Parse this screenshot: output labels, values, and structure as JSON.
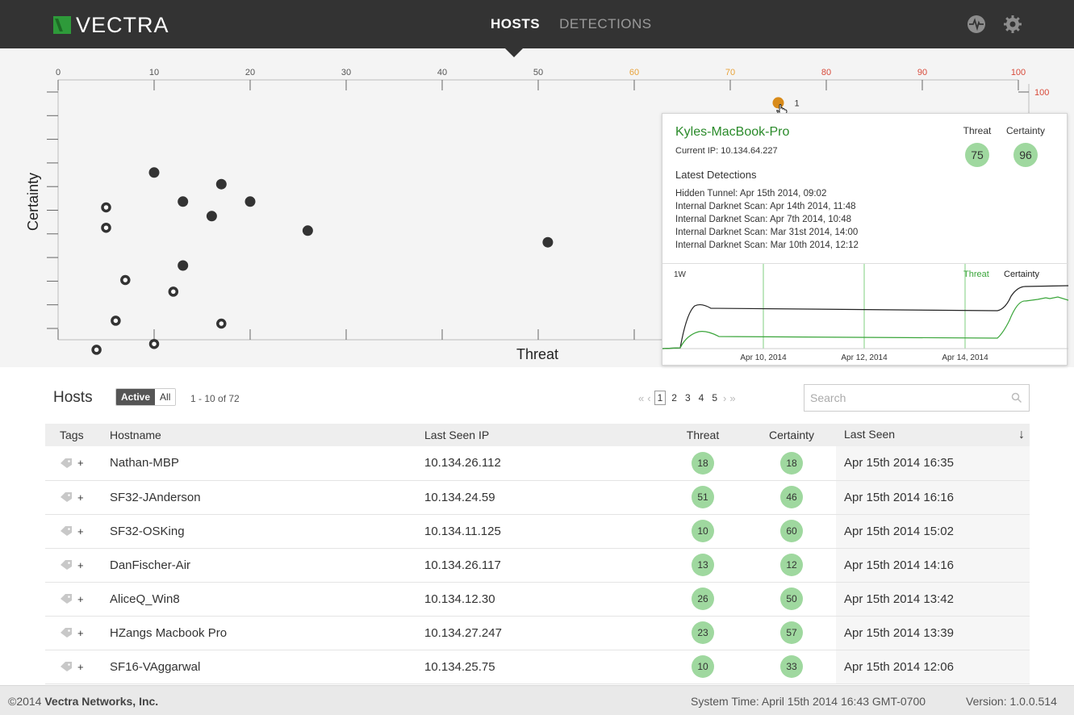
{
  "header": {
    "brand": "VECTRA",
    "tabs": [
      {
        "label": "HOSTS",
        "active": true
      },
      {
        "label": "DETECTIONS",
        "active": false
      }
    ],
    "icons": [
      "heartbeat-icon",
      "gear-icon"
    ]
  },
  "chart_data": {
    "type": "scatter",
    "xlabel": "Threat",
    "ylabel": "Certainty",
    "xlim": [
      0,
      100
    ],
    "ylim": [
      0,
      100
    ],
    "x_ticks": [
      0,
      10,
      20,
      30,
      40,
      50,
      60,
      70,
      80,
      90,
      100
    ],
    "y_ticks_visible": [
      100
    ],
    "tick_colors": {
      "0-50": "#555555",
      "60-70": "#e8a23a",
      "80-100": "#d84a3a"
    },
    "series": [
      {
        "style": "filled",
        "points": [
          [
            10,
            72
          ],
          [
            17,
            68
          ],
          [
            13,
            62
          ],
          [
            20,
            62
          ],
          [
            16,
            57
          ],
          [
            26,
            52
          ],
          [
            51,
            48
          ],
          [
            13,
            40
          ]
        ]
      },
      {
        "style": "hollow",
        "points": [
          [
            5,
            60
          ],
          [
            5,
            53
          ],
          [
            7,
            35
          ],
          [
            12,
            31
          ],
          [
            6,
            21
          ],
          [
            17,
            20
          ],
          [
            10,
            13
          ],
          [
            4,
            11
          ]
        ]
      },
      {
        "style": "highlighted",
        "color": "#d98b1a",
        "points": [
          [
            75,
            96
          ]
        ],
        "label": "1"
      }
    ]
  },
  "popup": {
    "hostname": "Kyles-MacBook-Pro",
    "ip_label": "Current IP:",
    "ip": "10.134.64.227",
    "threat_label": "Threat",
    "certainty_label": "Certainty",
    "threat": "75",
    "certainty": "96",
    "latest_label": "Latest Detections",
    "detections": [
      "Hidden Tunnel: Apr 15th 2014, 09:02",
      "Internal Darknet Scan: Apr 14th 2014, 11:48",
      "Internal Darknet Scan: Apr 7th 2014, 10:48",
      "Internal Darknet Scan: Mar 31st 2014, 14:00",
      "Internal Darknet Scan: Mar 10th 2014, 12:12"
    ],
    "timeline": {
      "range_label": "1W",
      "legend": [
        "Threat",
        "Certainty"
      ],
      "x_labels": [
        "Apr 10, 2014",
        "Apr 12, 2014",
        "Apr 14, 2014"
      ],
      "threat_color": "#3aa53a",
      "certainty_color": "#222222"
    }
  },
  "hosts": {
    "title": "Hosts",
    "filter": [
      {
        "label": "Active",
        "active": true
      },
      {
        "label": "All",
        "active": false
      }
    ],
    "count": "1 - 10 of 72",
    "pager": {
      "prev_first": "«",
      "prev": "‹",
      "pages": [
        "1",
        "2",
        "3",
        "4",
        "5"
      ],
      "current": "1",
      "next": "›",
      "next_last": "»"
    },
    "search_placeholder": "Search",
    "columns": [
      "Tags",
      "Hostname",
      "Last Seen IP",
      "Threat",
      "Certainty",
      "Last Seen"
    ],
    "sort_indicator": "↓",
    "rows": [
      {
        "tag": "+",
        "hostname": "Nathan-MBP",
        "ip": "10.134.26.112",
        "threat": "18",
        "certainty": "18",
        "last_seen": "Apr 15th 2014 16:35"
      },
      {
        "tag": "+",
        "hostname": "SF32-JAnderson",
        "ip": "10.134.24.59",
        "threat": "51",
        "certainty": "46",
        "last_seen": "Apr 15th 2014 16:16"
      },
      {
        "tag": "+",
        "hostname": "SF32-OSKing",
        "ip": "10.134.11.125",
        "threat": "10",
        "certainty": "60",
        "last_seen": "Apr 15th 2014 15:02"
      },
      {
        "tag": "+",
        "hostname": "DanFischer-Air",
        "ip": "10.134.26.117",
        "threat": "13",
        "certainty": "12",
        "last_seen": "Apr 15th 2014 14:16"
      },
      {
        "tag": "+",
        "hostname": "AliceQ_Win8",
        "ip": "10.134.12.30",
        "threat": "26",
        "certainty": "50",
        "last_seen": "Apr 15th 2014 13:42"
      },
      {
        "tag": "+",
        "hostname": "HZangs Macbook Pro",
        "ip": "10.134.27.247",
        "threat": "23",
        "certainty": "57",
        "last_seen": "Apr 15th 2014 13:39"
      },
      {
        "tag": "+",
        "hostname": "SF16-VAggarwal",
        "ip": "10.134.25.75",
        "threat": "10",
        "certainty": "33",
        "last_seen": "Apr 15th 2014 12:06"
      }
    ]
  },
  "footer": {
    "copyright_prefix": "©2014 ",
    "company": "Vectra Networks, Inc.",
    "system_time": "System Time: April 15th 2014 16:43 GMT-0700",
    "version": "Version: 1.0.0.514"
  }
}
